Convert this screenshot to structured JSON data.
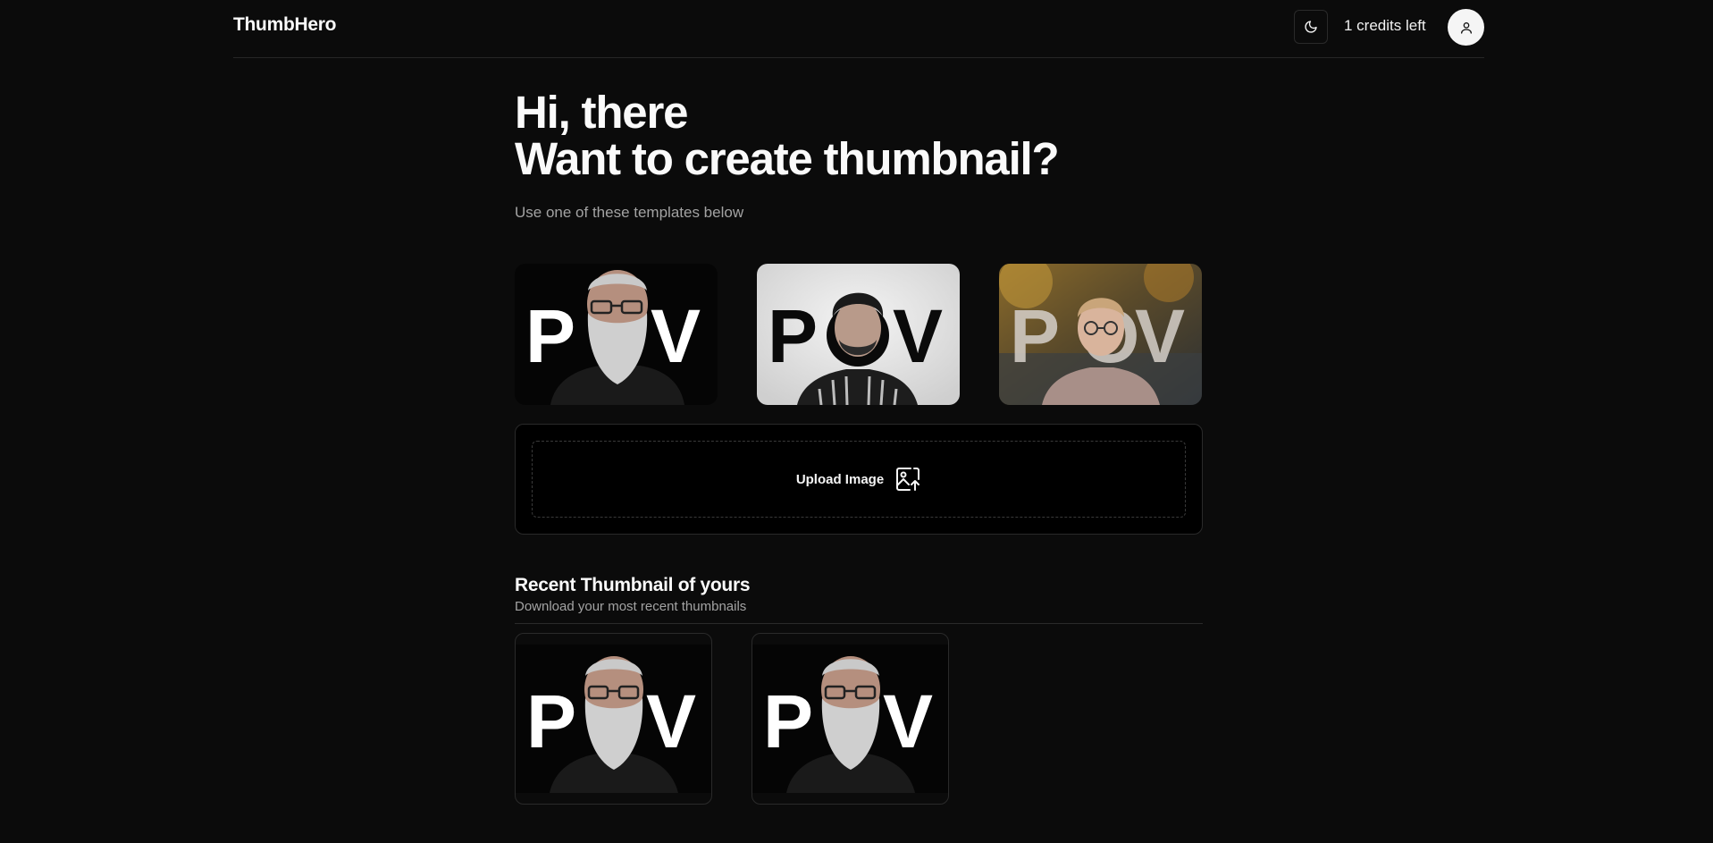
{
  "header": {
    "brand": "ThumbHero",
    "theme_toggle_icon": "moon-icon",
    "credits": "1 credits left",
    "avatar_icon": "user-icon"
  },
  "hero": {
    "line1": "Hi, there",
    "line2": "Want to create thumbnail?",
    "subtitle": "Use one of these templates below"
  },
  "templates": [
    {
      "id": "template-bearded",
      "text": "POV",
      "style": "dark background, white letters"
    },
    {
      "id": "template-curly",
      "text": "POV",
      "style": "light background, black letters"
    },
    {
      "id": "template-outdoor",
      "text": "POV",
      "style": "autumn background, light letters"
    }
  ],
  "upload": {
    "label": "Upload Image",
    "icon": "image-upload-icon"
  },
  "recent": {
    "title": "Recent Thumbnail of yours",
    "subtitle": "Download your most recent thumbnails",
    "items": [
      {
        "text": "POV"
      },
      {
        "text": "POV"
      }
    ]
  },
  "colors": {
    "background": "#0b0b0b",
    "text": "#fafafa",
    "muted": "#a3a3a3",
    "border": "#2a2a2a"
  }
}
